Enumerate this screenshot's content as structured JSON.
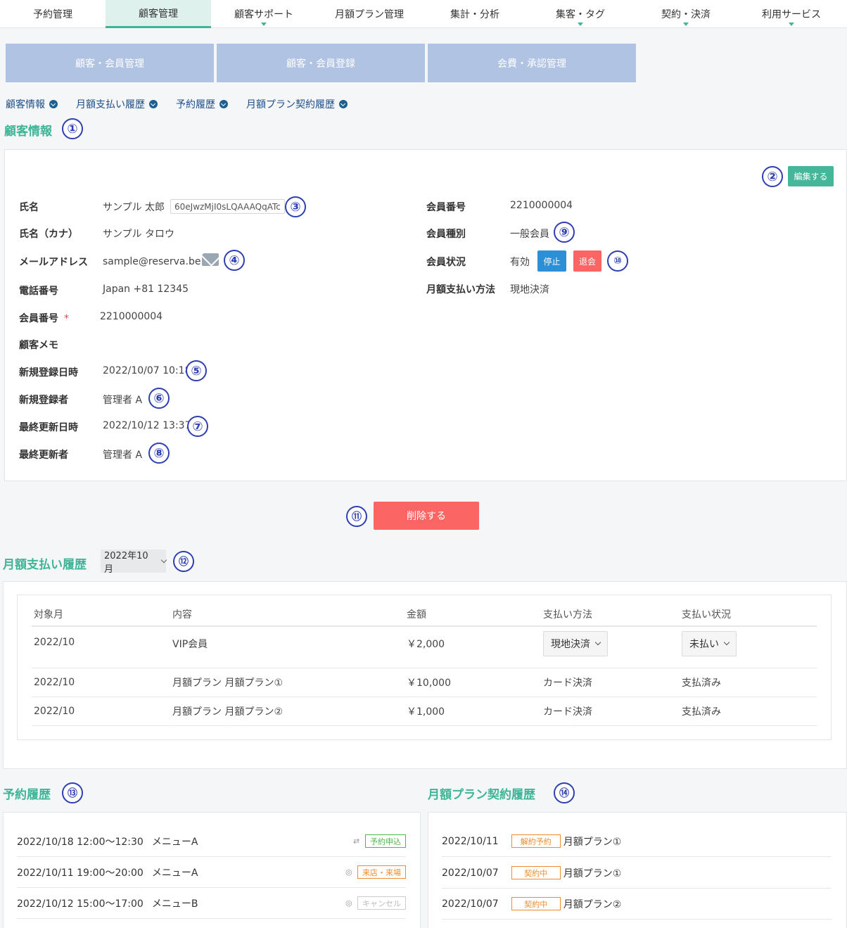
{
  "top_nav": [
    {
      "label": "予約管理",
      "active": false,
      "has_caret": false
    },
    {
      "label": "顧客管理",
      "active": true,
      "has_caret": false
    },
    {
      "label": "顧客サポート",
      "active": false,
      "has_caret": true
    },
    {
      "label": "月額プラン管理",
      "active": false,
      "has_caret": false
    },
    {
      "label": "集計・分析",
      "active": false,
      "has_caret": false
    },
    {
      "label": "集客・タグ",
      "active": false,
      "has_caret": true
    },
    {
      "label": "契約・決済",
      "active": false,
      "has_caret": true
    },
    {
      "label": "利用サービス",
      "active": false,
      "has_caret": true
    }
  ],
  "sub_nav": [
    "顧客・会員管理",
    "顧客・会員登録",
    "会費・承認管理"
  ],
  "anchor_links": [
    "顧客情報",
    "月額支払い履歴",
    "予約履歴",
    "月額プラン契約履歴"
  ],
  "markers": [
    "①",
    "②",
    "③",
    "④",
    "⑤",
    "⑥",
    "⑦",
    "⑧",
    "⑨",
    "⑩",
    "⑪",
    "⑫",
    "⑬",
    "⑭"
  ],
  "customer_info": {
    "title": "顧客情報",
    "edit_label": "編集する",
    "name_label": "氏名",
    "name_value": "サンプル 太郎",
    "id_tag": "60eJwzMjI0sLQAAAQqATc",
    "kana_label": "氏名（カナ）",
    "kana_value": "サンプル タロウ",
    "email_label": "メールアドレス",
    "email_value": "sample@reserva.be",
    "phone_label": "電話番号",
    "phone_value": "Japan +81 12345",
    "member_no_label": "会員番号",
    "member_no_required": "*",
    "member_no_value": "2210000004",
    "memo_label": "顧客メモ",
    "created_at_label": "新規登録日時",
    "created_at_value": "2022/10/07 10:18",
    "created_by_label": "新規登録者",
    "created_by_value": "管理者 A",
    "updated_at_label": "最終更新日時",
    "updated_at_value": "2022/10/12 13:37",
    "updated_by_label": "最終更新者",
    "updated_by_value": "管理者 A",
    "right": {
      "member_no_label": "会員番号",
      "member_no_value": "2210000004",
      "member_type_label": "会員種別",
      "member_type_value": "一般会員",
      "member_status_label": "会員状況",
      "member_status_value": "有効",
      "suspend_label": "停止",
      "withdraw_label": "退会",
      "payment_method_label": "月額支払い方法",
      "payment_method_value": "現地決済"
    },
    "delete_label": "削除する"
  },
  "payment_history": {
    "title": "月額支払い履歴",
    "month_selected": "2022年10月",
    "headers": [
      "対象月",
      "内容",
      "金額",
      "支払い方法",
      "支払い状況"
    ],
    "rows": [
      {
        "month": "2022/10",
        "content": "VIP会員",
        "amount": "￥2,000",
        "method": "現地決済",
        "status": "未払い"
      },
      {
        "month": "2022/10",
        "content": "月額プラン 月額プラン①",
        "amount": "￥10,000",
        "method": "カード決済",
        "status": "支払済み"
      },
      {
        "month": "2022/10",
        "content": "月額プラン 月額プラン②",
        "amount": "￥1,000",
        "method": "カード決済",
        "status": "支払済み"
      }
    ]
  },
  "reservation_history": {
    "title": "予約履歴",
    "items": [
      {
        "datetime": "2022/10/18 12:00～12:30",
        "menu": "メニューA",
        "status": "予約申込",
        "color": "green"
      },
      {
        "datetime": "2022/10/11 19:00～20:00",
        "menu": "メニューA",
        "status": "来店・来場",
        "color": "orange"
      },
      {
        "datetime": "2022/10/12 15:00～17:00",
        "menu": "メニューB",
        "status": "キャンセル",
        "color": "gray"
      }
    ]
  },
  "plan_history": {
    "title": "月額プラン契約履歴",
    "items": [
      {
        "date": "2022/10/11",
        "status": "解約予約",
        "plan": "月額プラン①"
      },
      {
        "date": "2022/10/07",
        "status": "契約中",
        "plan": "月額プラン①"
      },
      {
        "date": "2022/10/07",
        "status": "契約中",
        "plan": "月額プラン②"
      }
    ]
  },
  "colors": {
    "accent": "#3fb497",
    "marker": "#2f3fb3",
    "danger": "#fb6564",
    "primary": "#2d8fd5",
    "subnav": "#b0c3e2"
  }
}
